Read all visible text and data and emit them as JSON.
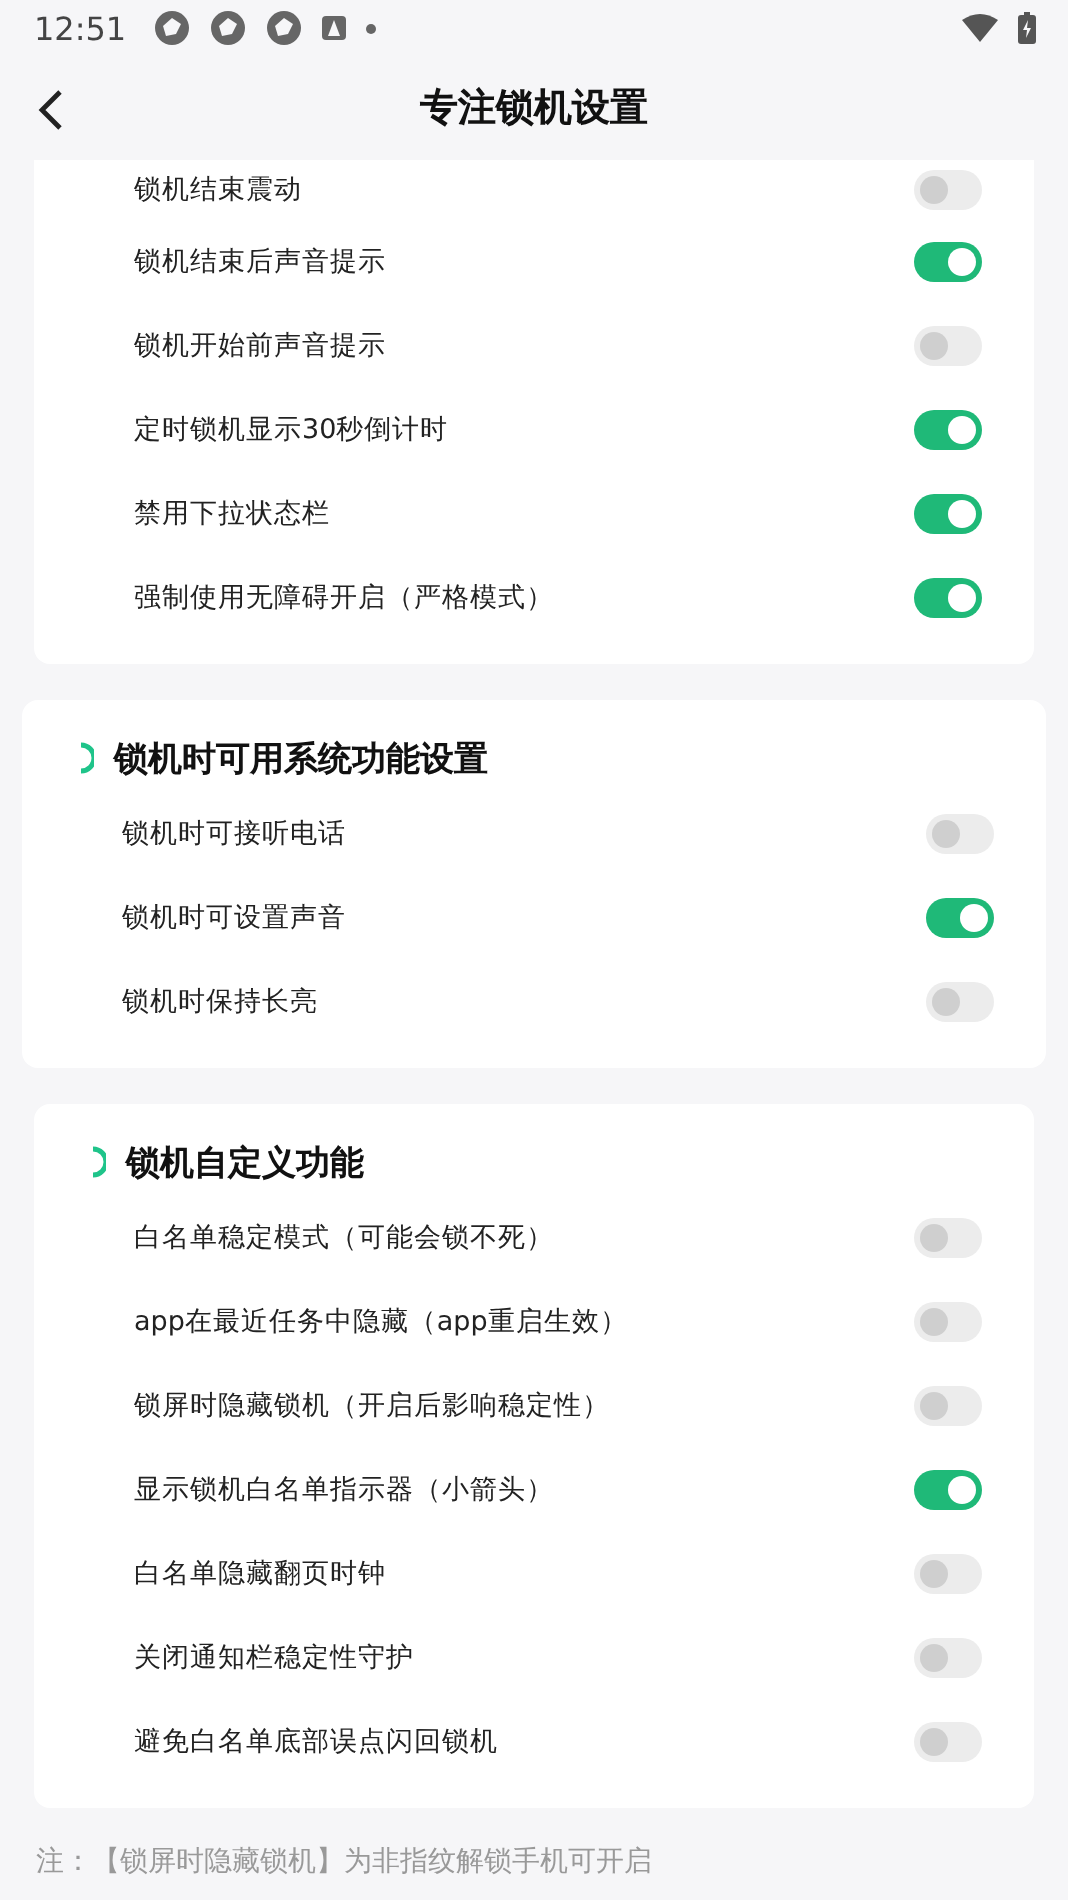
{
  "status_bar": {
    "time": "12:51"
  },
  "header": {
    "title": "专注锁机设置"
  },
  "sections": [
    {
      "items": [
        {
          "label": "锁机结束震动",
          "on": false
        },
        {
          "label": "锁机结束后声音提示",
          "on": true
        },
        {
          "label": "锁机开始前声音提示",
          "on": false
        },
        {
          "label": "定时锁机显示30秒倒计时",
          "on": true
        },
        {
          "label": "禁用下拉状态栏",
          "on": true
        },
        {
          "label": "强制使用无障碍开启（严格模式）",
          "on": true
        }
      ]
    },
    {
      "title": "锁机时可用系统功能设置",
      "items": [
        {
          "label": "锁机时可接听电话",
          "on": false
        },
        {
          "label": "锁机时可设置声音",
          "on": true
        },
        {
          "label": "锁机时保持长亮",
          "on": false
        }
      ]
    },
    {
      "title": "锁机自定义功能",
      "items": [
        {
          "label": "白名单稳定模式（可能会锁不死）",
          "on": false
        },
        {
          "label": "app在最近任务中隐藏（app重启生效）",
          "on": false
        },
        {
          "label": "锁屏时隐藏锁机（开启后影响稳定性）",
          "on": false
        },
        {
          "label": "显示锁机白名单指示器（小箭头）",
          "on": true
        },
        {
          "label": "白名单隐藏翻页时钟",
          "on": false
        },
        {
          "label": "关闭通知栏稳定性守护",
          "on": false
        },
        {
          "label": "避免白名单底部误点闪回锁机",
          "on": false
        }
      ]
    }
  ],
  "note": "注：【锁屏时隐藏锁机】为非指纹解锁手机可开启"
}
